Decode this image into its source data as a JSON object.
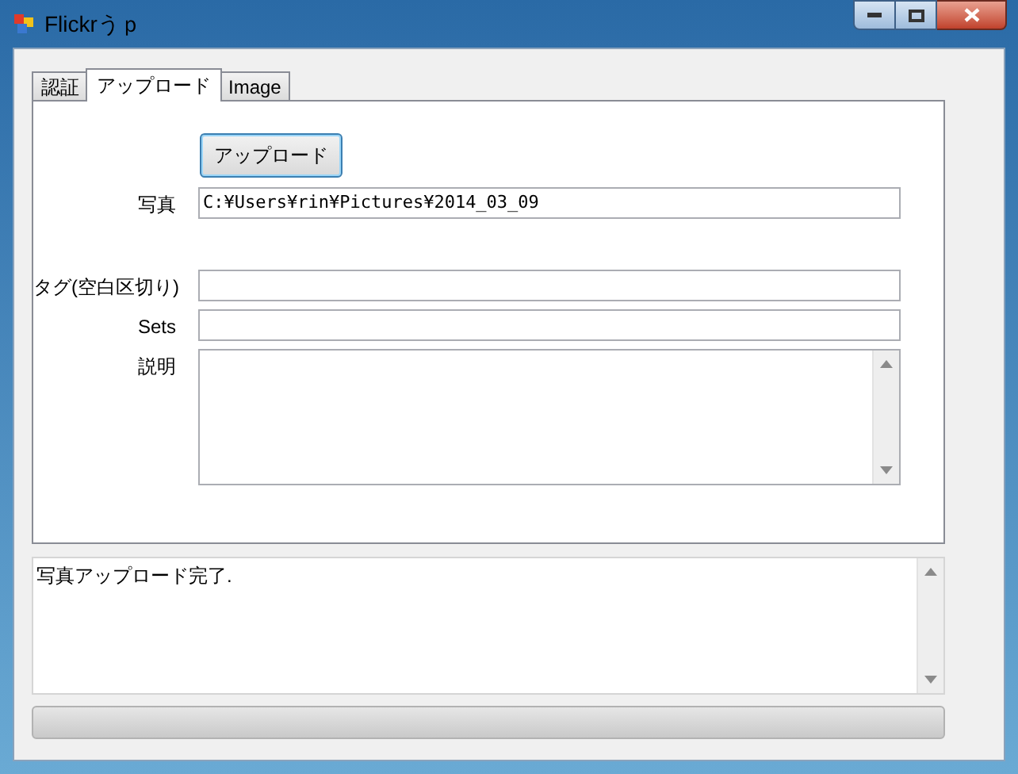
{
  "window": {
    "title": "Flickrうｐ"
  },
  "tabs": [
    {
      "label": "認証",
      "selected": false
    },
    {
      "label": "アップロード",
      "selected": true
    },
    {
      "label": "Image",
      "selected": false
    }
  ],
  "upload_button": "アップロード",
  "photo": {
    "label": "写真",
    "value": "C:¥Users¥rin¥Pictures¥2014_03_09"
  },
  "fields": [
    {
      "label": "タグ(空白区切り)",
      "kind": "line"
    },
    {
      "label": "Sets",
      "kind": "line"
    },
    {
      "label": "説明",
      "kind": "multiline"
    }
  ],
  "log": {
    "text": "写真アップロード完了."
  },
  "progress": {
    "level": 0
  }
}
